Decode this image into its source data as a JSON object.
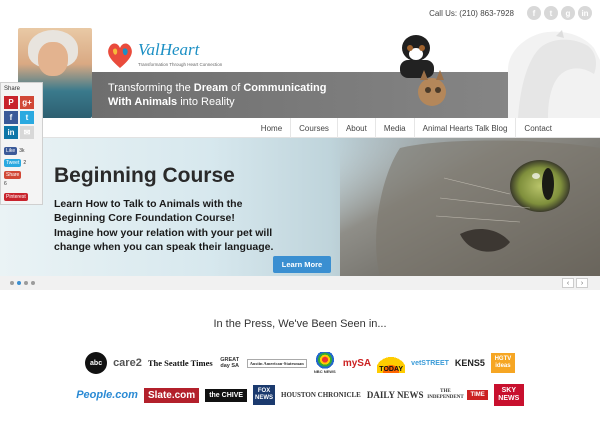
{
  "topbar": {
    "call_us": "Call Us: (210) 863-7928",
    "social_icons": [
      "facebook-icon",
      "twitter-icon",
      "google-plus-icon",
      "linkedin-icon"
    ]
  },
  "logo": {
    "name": "ValHeart",
    "tagline": "Transformation Through Heart Connection"
  },
  "banner": {
    "line1_plain": "Transforming the ",
    "line1_bold": "Dream",
    "line1_end": " of ",
    "line1_bold2": "Communicating",
    "line2_bold": "With Animals",
    "line2_end": " into Reality"
  },
  "nav": {
    "items": [
      "Home",
      "Courses",
      "About",
      "Media",
      "Animal Hearts Talk Blog",
      "Contact"
    ]
  },
  "hero": {
    "title": "Beginning Course",
    "sub1": "Learn How to Talk to Animals with the",
    "sub2": "Beginning Core Foundation Course!",
    "sub3": "Imagine how your relation with your pet will",
    "sub4": "change when you can speak their language.",
    "button": "Learn More"
  },
  "slider": {
    "prev": "‹",
    "next": "›",
    "active_dot": 1
  },
  "share": {
    "title": "Share",
    "fb_like": "Like",
    "fb_count": "3k",
    "tweet": "Tweet",
    "tweet_count": "2",
    "gshare": "Share",
    "gshare_count": "6",
    "pinterest": "Pinterest"
  },
  "press": {
    "title": "In the Press, We've Been Seen in...",
    "row1": [
      "abc",
      "care2",
      "The Seattle Times",
      "GREAT day SA",
      "Austin American-Statesman",
      "NBC NEWS",
      "mySA",
      "TODAY",
      "vetSTREET",
      "KENS5",
      "HGTV ideas"
    ],
    "row2": [
      "People.com",
      "Slate.com",
      "the CHIVE",
      "FOX NEWS",
      "HOUSTON CHRONICLE",
      "DAILY NEWS",
      "THE INDEPENDENT",
      "TIME",
      "SKY NEWS"
    ]
  }
}
